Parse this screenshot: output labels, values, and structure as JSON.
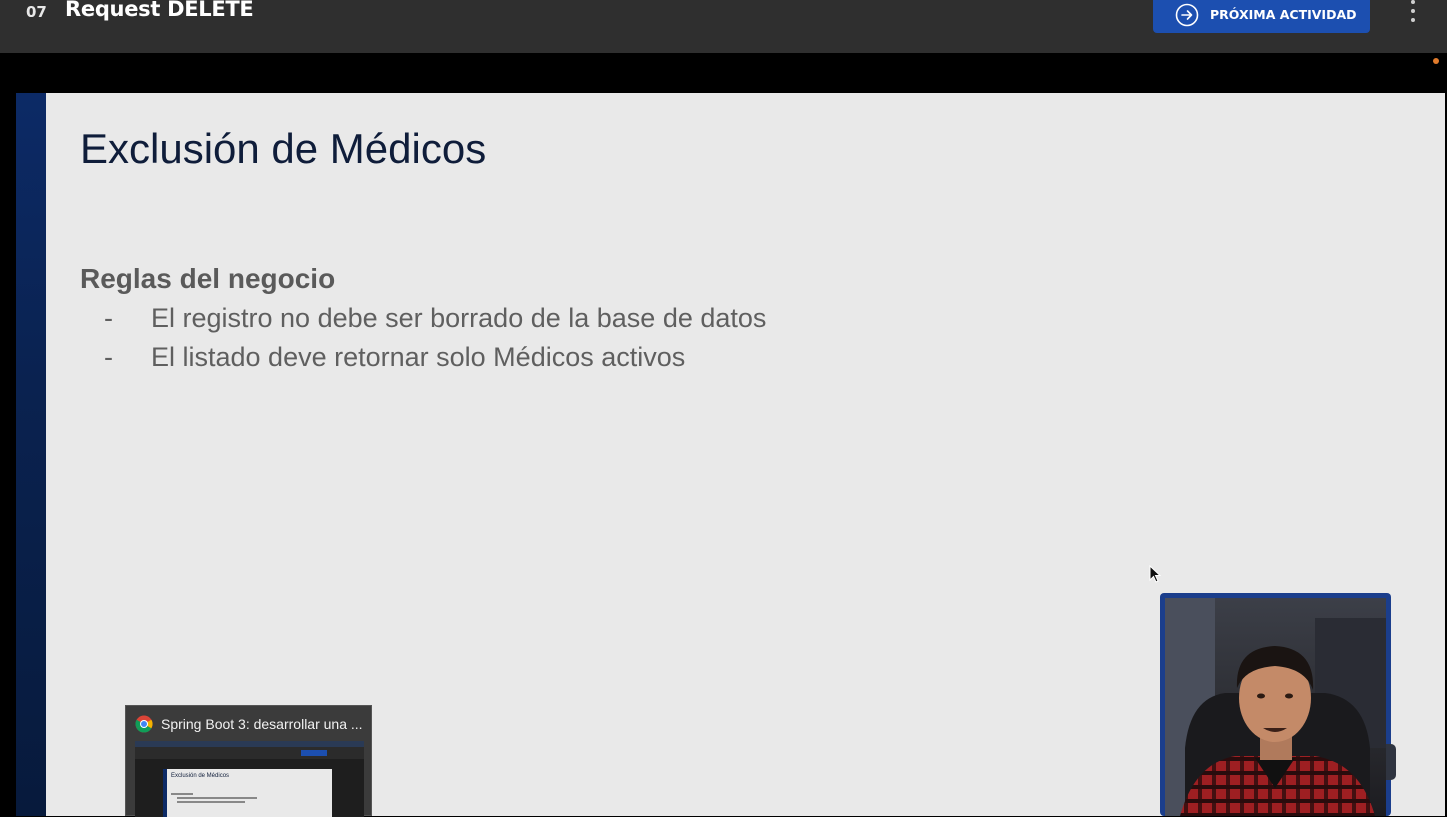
{
  "header": {
    "lesson_number": "07",
    "lesson_title": "Request DELETE",
    "next_button_label": "PRÓXIMA ACTIVIDAD",
    "next_icon": "arrow-right-circle-icon",
    "menu_icon": "more-vertical-icon"
  },
  "slide": {
    "title": "Exclusión de Médicos",
    "rules_heading": "Reglas del negocio",
    "rules": [
      {
        "bullet": "-",
        "text": "El registro no debe ser borrado de la base de datos"
      },
      {
        "bullet": "-",
        "text": "El listado deve retornar solo Médicos activos"
      }
    ]
  },
  "taskbar_preview": {
    "icon": "chrome-icon",
    "title": "Spring Boot 3: desarrollar una ..."
  },
  "colors": {
    "accent": "#1c4fb0",
    "topbar": "#2f2f2f",
    "slide_background": "#e9e9e9",
    "slide_title": "#0f1d3a",
    "slide_text": "#5f5f5f"
  }
}
